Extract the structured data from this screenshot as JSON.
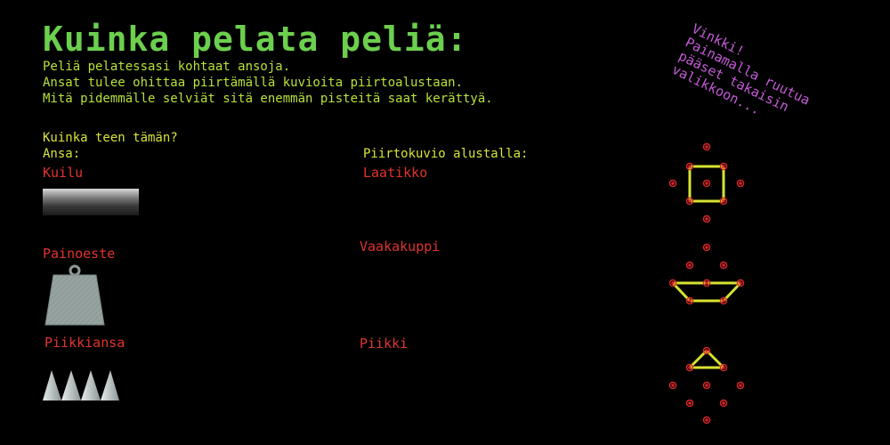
{
  "title": "Kuinka pelata peliä:",
  "intro": [
    "Peliä pelatessasi kohtaat ansoja.",
    "Ansat tulee ohittaa piirtämällä kuvioita piirtoalustaan.",
    "Mitä pidemmälle selviät sitä enemmän pisteitä saat kerättyä."
  ],
  "howto_label": "Kuinka teen tämän?",
  "trap_header": "Ansa:",
  "pattern_header": "Piirtokuvio alustalla:",
  "traps": [
    {
      "name": "Kuilu",
      "icon": "pit-icon"
    },
    {
      "name": "Painoeste",
      "icon": "weight-icon"
    },
    {
      "name": "Piikkiansa",
      "icon": "spike-trap-icon"
    }
  ],
  "patterns": [
    {
      "name": "Laatikko",
      "icon": "box-pattern-icon"
    },
    {
      "name": "Vaakakuppi",
      "icon": "cup-pattern-icon"
    },
    {
      "name": "Piikki",
      "icon": "spike-pattern-icon"
    }
  ],
  "hint_lines": [
    "Vinkki!",
    "Painamalla ruutua",
    "pääset takaisin",
    "valikkoon..."
  ],
  "colors": {
    "background": "#000000",
    "title": "#6ccf4e",
    "text": "#b9e23a",
    "trap_name": "#e0332f",
    "hint": "#c45bd6",
    "pattern_line": "#d6e332",
    "pattern_dot": "#d9262a"
  }
}
